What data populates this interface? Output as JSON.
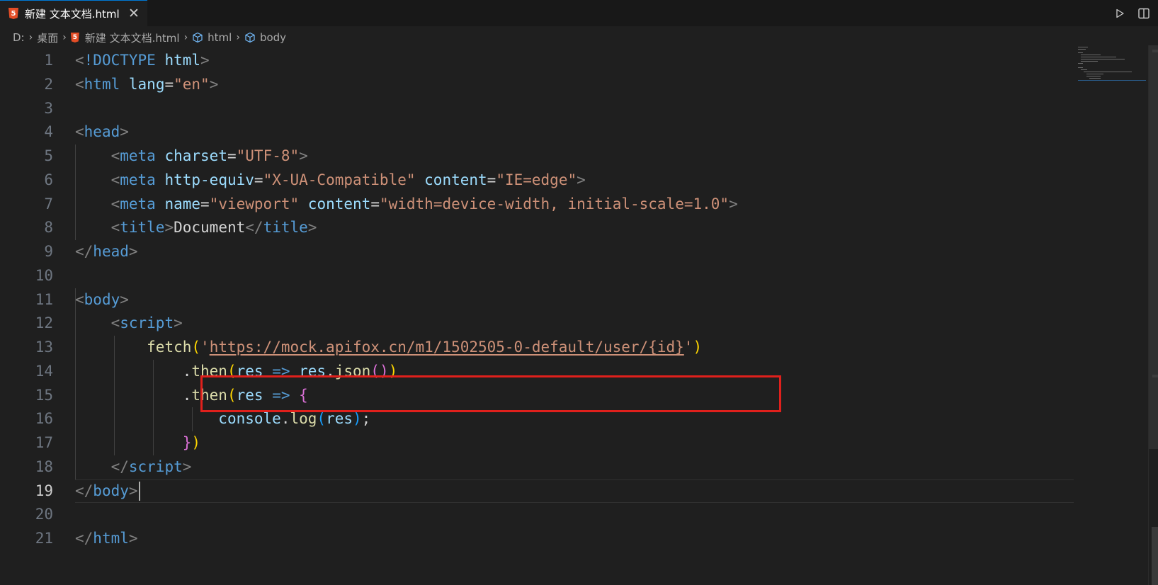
{
  "tab": {
    "file_name": "新建 文本文档.html",
    "icon": "html5-icon",
    "icon_glyph": "5",
    "close_glyph": "✕"
  },
  "actions": {
    "run_icon": "play-icon",
    "split_icon": "split-editor-icon"
  },
  "breadcrumb": {
    "drive": "D:",
    "folder": "桌面",
    "file": "新建 文本文档.html",
    "symbol1": "html",
    "symbol2": "body",
    "separator": "›"
  },
  "editor": {
    "active_line": 19,
    "line_numbers": [
      "1",
      "2",
      "3",
      "4",
      "5",
      "6",
      "7",
      "8",
      "9",
      "10",
      "11",
      "12",
      "13",
      "14",
      "15",
      "16",
      "17",
      "18",
      "19",
      "20",
      "21"
    ],
    "highlight_color": "#e0201c"
  },
  "code": {
    "l1": {
      "lt": "<",
      "bang": "!DOCTYPE",
      "sp": " ",
      "name": "html",
      "gt": ">"
    },
    "l2": {
      "lt": "<",
      "tag": "html",
      "sp": " ",
      "attr": "lang",
      "eq": "=",
      "val": "\"en\"",
      "gt": ">"
    },
    "l4": {
      "lt": "<",
      "tag": "head",
      "gt": ">"
    },
    "l5": {
      "indent": "    ",
      "lt": "<",
      "tag": "meta",
      "sp": " ",
      "attr": "charset",
      "eq": "=",
      "val": "\"UTF-8\"",
      "gt": ">"
    },
    "l6": {
      "indent": "    ",
      "lt": "<",
      "tag": "meta",
      "sp": " ",
      "attr1": "http-equiv",
      "eq1": "=",
      "val1": "\"X-UA-Compatible\"",
      "sp2": " ",
      "attr2": "content",
      "eq2": "=",
      "val2": "\"IE=edge\"",
      "gt": ">"
    },
    "l7": {
      "indent": "    ",
      "lt": "<",
      "tag": "meta",
      "sp": " ",
      "attr1": "name",
      "eq1": "=",
      "val1": "\"viewport\"",
      "sp2": " ",
      "attr2": "content",
      "eq2": "=",
      "val2": "\"width=device-width, initial-scale=1.0\"",
      "gt": ">"
    },
    "l8": {
      "indent": "    ",
      "lt": "<",
      "tag": "title",
      "gt": ">",
      "text": "Document",
      "lt2": "</",
      "tag2": "title",
      "gt2": ">"
    },
    "l9": {
      "lt": "</",
      "tag": "head",
      "gt": ">"
    },
    "l11": {
      "lt": "<",
      "tag": "body",
      "gt": ">"
    },
    "l12": {
      "indent": "    ",
      "lt": "<",
      "tag": "script",
      "gt": ">"
    },
    "l13": {
      "indent": "        ",
      "fn": "fetch",
      "open": "(",
      "q1": "'",
      "url": "https://mock.apifox.cn/m1/1502505-0-default/user/{id}",
      "q2": "'",
      "close": ")"
    },
    "l14": {
      "indent": "            ",
      "dot": ".",
      "fn": "then",
      "open": "(",
      "param": "res",
      "arrow": " => ",
      "obj": "res",
      "dot2": ".",
      "fn2": "json",
      "open2": "(",
      "close2": ")",
      "close": ")"
    },
    "l15": {
      "indent": "            ",
      "dot": ".",
      "fn": "then",
      "open": "(",
      "param": "res",
      "arrow": " => ",
      "brace": "{"
    },
    "l16": {
      "indent": "                ",
      "obj": "console",
      "dot": ".",
      "fn": "log",
      "open": "(",
      "arg": "res",
      "close": ")",
      "semi": ";"
    },
    "l17": {
      "indent": "            ",
      "brace": "}",
      "close": ")"
    },
    "l18": {
      "indent": "    ",
      "lt": "</",
      "tag": "script",
      "gt": ">"
    },
    "l19": {
      "lt": "</",
      "tag": "body",
      "gt": ">"
    },
    "l21": {
      "lt": "</",
      "tag": "html",
      "gt": ">"
    }
  }
}
